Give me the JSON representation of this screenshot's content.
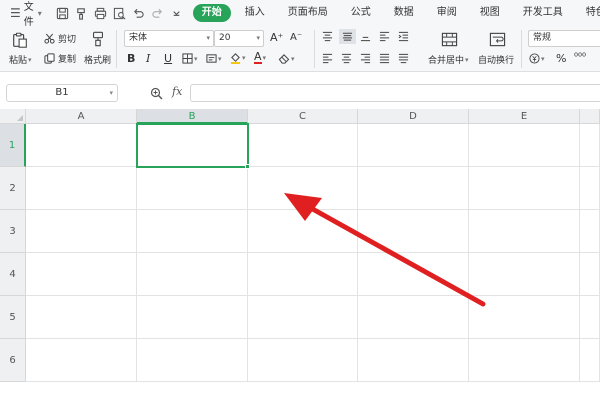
{
  "menubar": {
    "file_label": "文件",
    "tabs": [
      {
        "label": "开始",
        "active": true
      },
      {
        "label": "插入",
        "active": false
      },
      {
        "label": "页面布局",
        "active": false
      },
      {
        "label": "公式",
        "active": false
      },
      {
        "label": "数据",
        "active": false
      },
      {
        "label": "审阅",
        "active": false
      },
      {
        "label": "视图",
        "active": false
      },
      {
        "label": "开发工具",
        "active": false
      },
      {
        "label": "特色功能",
        "active": false
      }
    ],
    "quick_access_icons": [
      "save-icon",
      "format-painter-icon",
      "print-icon",
      "print-preview-icon",
      "undo-icon",
      "redo-icon",
      "customize-icon"
    ]
  },
  "ribbon": {
    "paste_label": "粘贴",
    "cut_label": "剪切",
    "copy_label": "复制",
    "format_painter_label": "格式刷",
    "font_name": "宋体",
    "font_size": "20",
    "bold": "B",
    "italic": "I",
    "underline": "U",
    "increase_font": "A⁺",
    "decrease_font": "A⁻",
    "font_color_letter": "A",
    "merge_center_label": "合并居中",
    "wrap_text_label": "自动换行",
    "number_format": "常规",
    "percent": "%",
    "thousands": "⁰⁰⁰"
  },
  "formula_bar": {
    "name_box": "B1",
    "fx_label": "fx",
    "value": ""
  },
  "grid": {
    "columns": [
      "A",
      "B",
      "C",
      "D",
      "E"
    ],
    "rows": [
      "1",
      "2",
      "3",
      "4",
      "5",
      "6"
    ],
    "selected_cell": "B1"
  },
  "colors": {
    "accent": "#27a35a",
    "arrow": "#e02020"
  }
}
